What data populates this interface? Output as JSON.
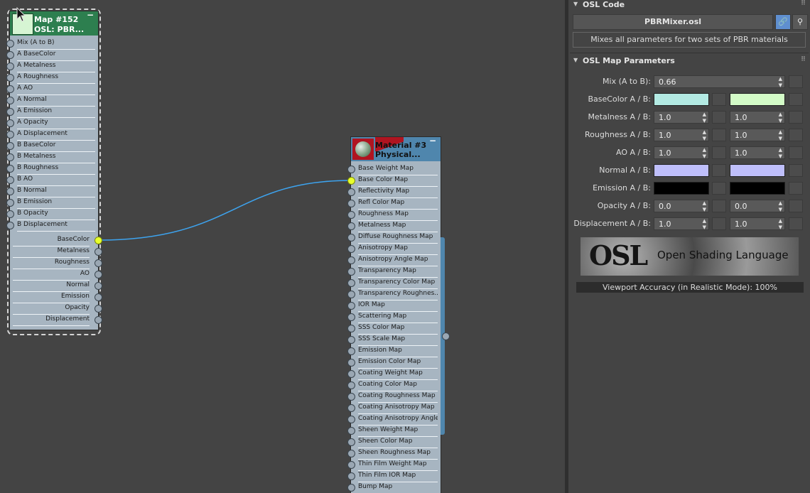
{
  "osl_node": {
    "title": "Map #152",
    "subtitle": "OSL: PBR...",
    "inputs": [
      "Mix (A to B)",
      "A BaseColor",
      "A Metalness",
      "A Roughness",
      "A AO",
      "A Normal",
      "A Emission",
      "A Opacity",
      "A Displacement",
      "B BaseColor",
      "B Metalness",
      "B Roughness",
      "B AO",
      "B Normal",
      "B Emission",
      "B Opacity",
      "B Displacement"
    ],
    "outputs": [
      "BaseColor",
      "Metalness",
      "Roughness",
      "AO",
      "Normal",
      "Emission",
      "Opacity",
      "Displacement"
    ]
  },
  "material_node": {
    "title": "Material #3",
    "subtitle": "Physical...",
    "inputs": [
      "Base Weight Map",
      "Base Color Map",
      "Reflectivity Map",
      "Refl Color Map",
      "Roughness Map",
      "Metalness Map",
      "Diffuse Roughness Map",
      "Anisotropy Map",
      "Anisotropy Angle Map",
      "Transparency Map",
      "Transparency Color Map",
      "Transparency Roughnes...",
      "IOR Map",
      "Scattering Map",
      "SSS Color Map",
      "SSS Scale Map",
      "Emission Map",
      "Emission Color Map",
      "Coating Weight Map",
      "Coating Color Map",
      "Coating Roughness Map",
      "Coating Anisotropy Map",
      "Coating Anisotropy Angle...",
      "Sheen Weight Map",
      "Sheen Color Map",
      "Sheen Roughness Map",
      "Thin Film Weight Map",
      "Thin Film IOR Map",
      "Bump Map"
    ]
  },
  "panel": {
    "osl_code": {
      "header": "OSL Code",
      "file": "PBRMixer.osl",
      "description": "Mixes all parameters for two sets of PBR materials"
    },
    "map_params": {
      "header": "OSL Map Parameters",
      "mix_label": "Mix (A to B):",
      "mix_value": "0.66",
      "params": [
        {
          "label": "BaseColor A / B:",
          "kind": "color",
          "a": "#b3eae3",
          "b": "#d3fbc7"
        },
        {
          "label": "Metalness A / B:",
          "kind": "number",
          "a": "1.0",
          "b": "1.0"
        },
        {
          "label": "Roughness A / B:",
          "kind": "number",
          "a": "1.0",
          "b": "1.0"
        },
        {
          "label": "AO A / B:",
          "kind": "number",
          "a": "1.0",
          "b": "1.0"
        },
        {
          "label": "Normal A / B:",
          "kind": "color",
          "a": "#bfbffb",
          "b": "#bfbffb"
        },
        {
          "label": "Emission A / B:",
          "kind": "color",
          "a": "#000000",
          "b": "#000000"
        },
        {
          "label": "Opacity A / B:",
          "kind": "number",
          "a": "0.0",
          "b": "0.0"
        },
        {
          "label": "Displacement A / B:",
          "kind": "number",
          "a": "1.0",
          "b": "1.0"
        }
      ],
      "logo_text": "OSL",
      "logo_subtext": "Open Shading Language",
      "accuracy": "Viewport Accuracy (in Realistic Mode): 100%"
    }
  },
  "icons": {
    "link": "link-icon",
    "search": "magnifier-icon",
    "collapse": "triangle-down-icon"
  },
  "colors": {
    "wire": "#3da4f0",
    "active_port": "#e8ff2d",
    "osl_header": "#2d7f4f",
    "material_header": "#4f86ad"
  }
}
